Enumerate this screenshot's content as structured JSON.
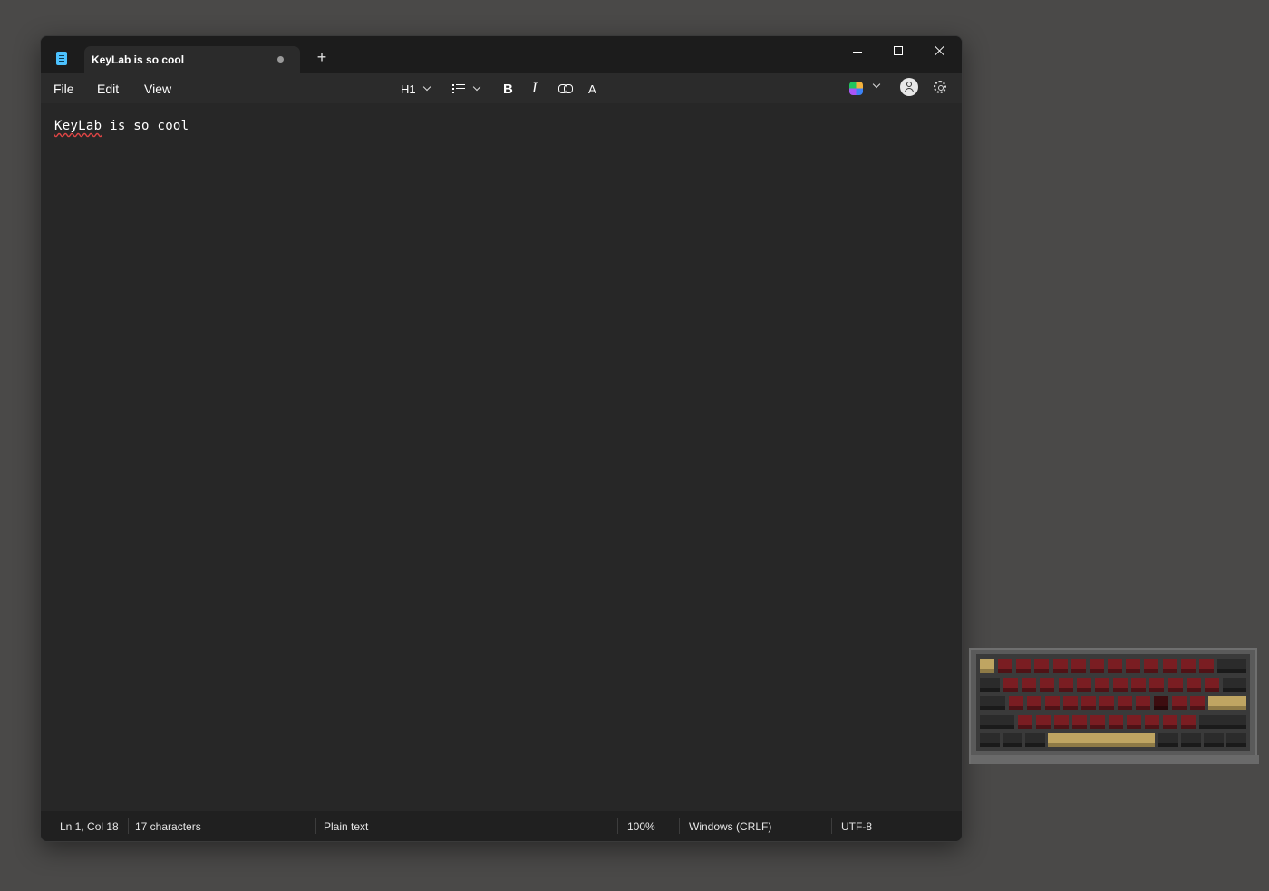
{
  "window": {
    "app_icon": "notepad-icon",
    "tab_title": "KeyLab is so cool",
    "tab_modified_indicator": "•",
    "new_tab_label": "+"
  },
  "menu": {
    "file": "File",
    "edit": "Edit",
    "view": "View"
  },
  "toolbar": {
    "heading": "H1",
    "list_icon": "bulleted-list-icon",
    "bold_icon": "B",
    "italic_icon": "I",
    "link_icon": "link-icon",
    "spellcheck_icon": "A",
    "copilot_icon": "copilot-icon",
    "account_icon": "account-icon",
    "settings_icon": "gear-icon"
  },
  "editor": {
    "text_misspelled": "KeyLab",
    "text_rest": " is so cool"
  },
  "status": {
    "position": "Ln 1, Col 18",
    "characters": "17 characters",
    "format": "Plain text",
    "zoom": "100%",
    "line_endings": "Windows (CRLF)",
    "encoding": "UTF-8"
  },
  "desktop_widget": {
    "name": "keyboard-widget"
  }
}
